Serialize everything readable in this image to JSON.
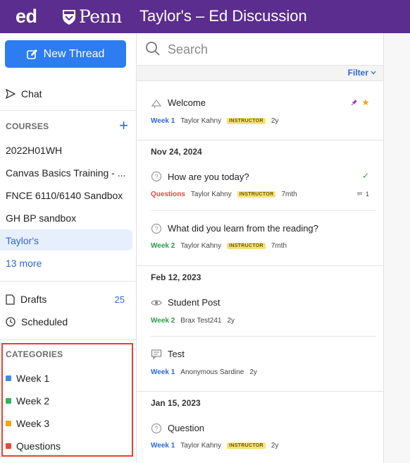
{
  "topbar": {
    "logo": "ed",
    "school": "Penn",
    "title": "Taylor's – Ed Discussion"
  },
  "sidebar": {
    "new_thread": "New Thread",
    "chat": "Chat",
    "courses_label": "COURSES",
    "courses": [
      "2022H01WH",
      "Canvas Basics Training - ...",
      "FNCE 6110/6140 Sandbox",
      "GH BP sandbox",
      "Taylor's"
    ],
    "more": "13 more",
    "drafts": "Drafts",
    "drafts_count": "25",
    "scheduled": "Scheduled",
    "categories_label": "CATEGORIES",
    "categories": [
      {
        "label": "Week 1",
        "color": "#3a8ee6"
      },
      {
        "label": "Week 2",
        "color": "#34b45a"
      },
      {
        "label": "Week 3",
        "color": "#f2a31f"
      },
      {
        "label": "Questions",
        "color": "#e04a3b"
      }
    ]
  },
  "threads": {
    "search_placeholder": "Search",
    "filter": "Filter",
    "dates": [
      "Nov 24, 2024",
      "Feb 12, 2023",
      "Jan 15, 2023"
    ],
    "items": [
      {
        "title": "Welcome",
        "category": "Week 1",
        "category_color": "#2d6ad6",
        "author": "Taylor Kahny",
        "badge": "INSTRUCTOR",
        "age": "2y",
        "icon": "announcement-icon"
      },
      {
        "title": "How are you today?",
        "category": "Questions",
        "category_color": "#e04a3b",
        "author": "Taylor Kahny",
        "badge": "INSTRUCTOR",
        "age": "7mth",
        "icon": "question-icon",
        "comments": "1"
      },
      {
        "title": "What did you learn from the reading?",
        "category": "Week 2",
        "category_color": "#2a9d4a",
        "author": "Taylor Kahny",
        "badge": "INSTRUCTOR",
        "age": "7mth",
        "icon": "question-icon"
      },
      {
        "title": "Student Post",
        "category": "Week 2",
        "category_color": "#2a9d4a",
        "author": "Brax Test241",
        "age": "2y",
        "icon": "eye-icon"
      },
      {
        "title": "Test",
        "category": "Week 1",
        "category_color": "#2d6ad6",
        "author": "Anonymous Sardine",
        "age": "2y",
        "icon": "post-icon"
      },
      {
        "title": "Question",
        "category": "Week 1",
        "category_color": "#2d6ad6",
        "author": "Taylor Kahny",
        "badge": "INSTRUCTOR",
        "age": "2y",
        "icon": "question-icon"
      }
    ]
  }
}
